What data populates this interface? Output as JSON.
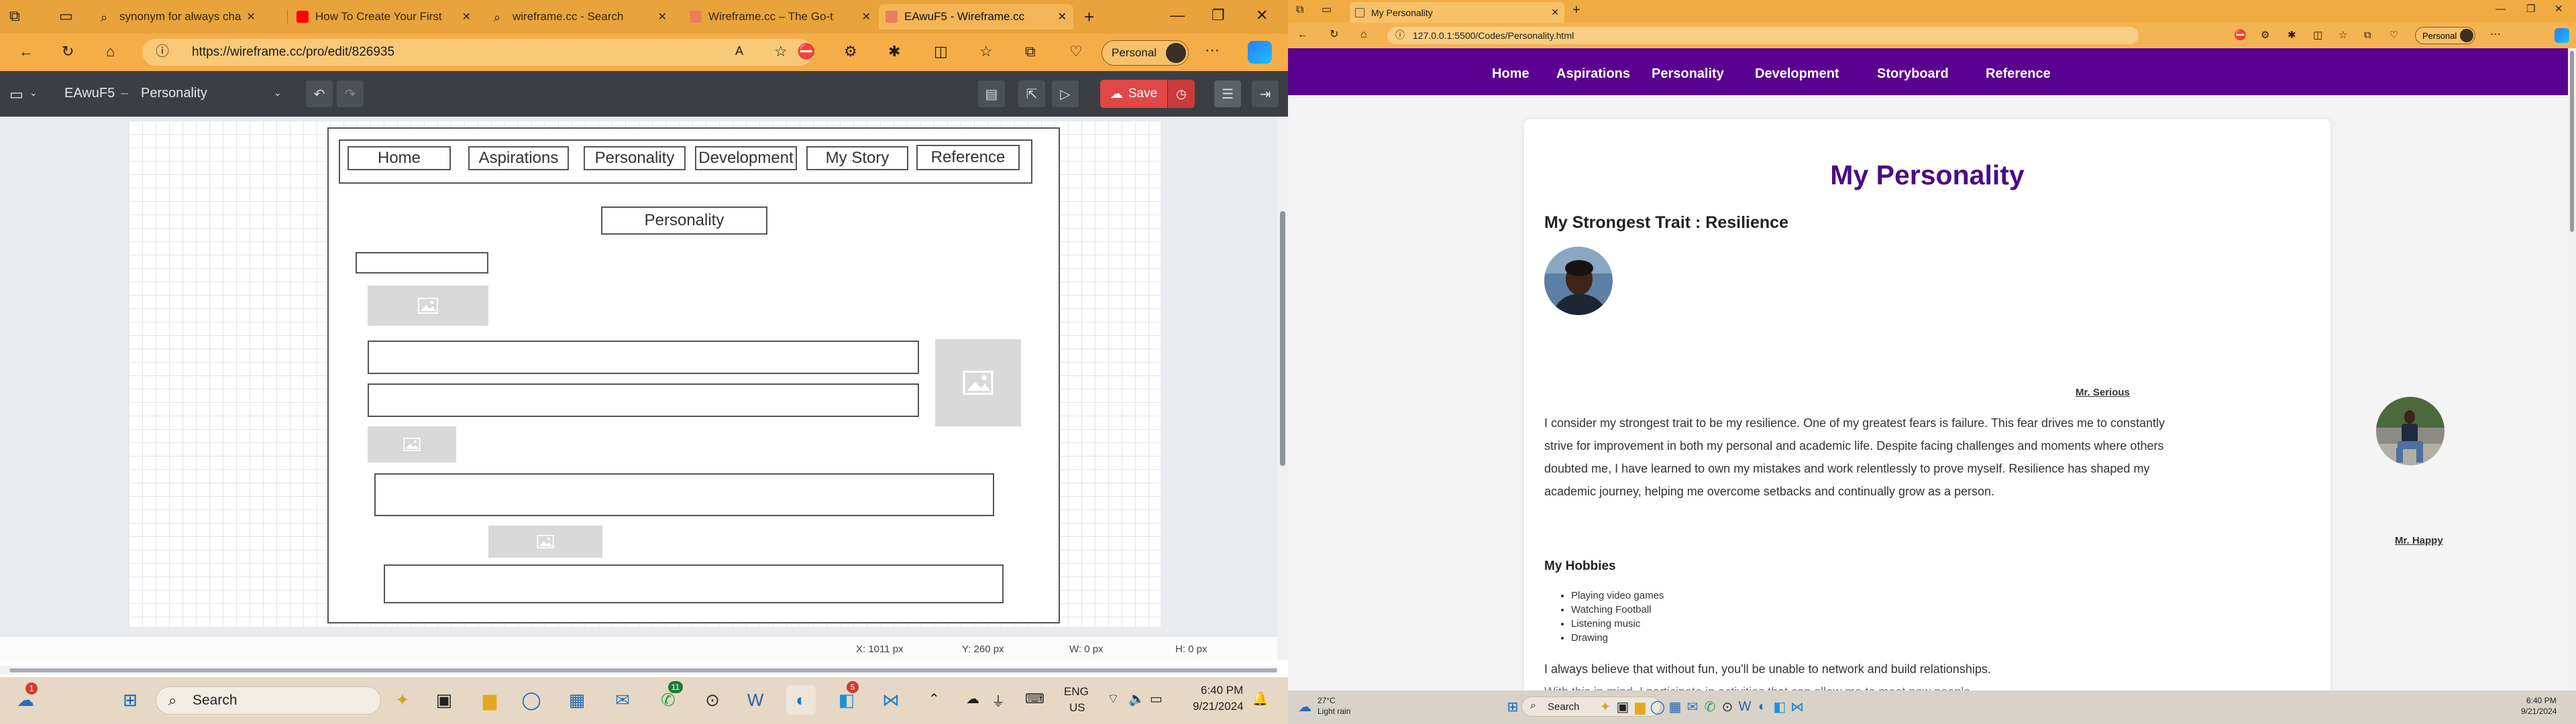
{
  "left": {
    "tabs": [
      {
        "title": "synonym for always cha",
        "icon": "search-icon",
        "color": "#e2a13f"
      },
      {
        "title": "How To Create Your First",
        "icon": "youtube-icon",
        "color": "#ff0000"
      },
      {
        "title": "wireframe.cc - Search",
        "icon": "search-icon",
        "color": "#e2a13f"
      },
      {
        "title": "Wireframe.cc – The Go-t",
        "icon": "wireframe-icon",
        "color": "#e97f5b"
      },
      {
        "title": "EAwuF5 - Wireframe.cc",
        "icon": "wireframe-icon",
        "color": "#e97f5b",
        "active": true
      }
    ],
    "url": "https://wireframe.cc/pro/edit/826935",
    "profile": "Personal",
    "app": {
      "doc_id": "EAwuF5",
      "separator": "–",
      "page_name": "Personality",
      "save_label": "Save"
    },
    "wireframe": {
      "nav": [
        "Home",
        "Aspirations",
        "Personality",
        "Development",
        "My Story",
        "Reference"
      ],
      "page_title": "Personality"
    },
    "status": {
      "x": "X: 1011 px",
      "y": "Y: 260 px",
      "w": "W: 0 px",
      "h": "H: 0 px"
    },
    "taskbar": {
      "search": "Search",
      "lang": "ENG",
      "region": "US",
      "time": "6:40 PM",
      "date": "9/21/2024",
      "notif_badge": "1",
      "whatsapp_badge": "11",
      "edge_badge": "5"
    }
  },
  "right": {
    "tab_title": "My Personality",
    "url": "127.0.0.1:5500/Codes/Personality.html",
    "profile": "Personal",
    "nav": [
      "Home",
      "Aspirations",
      "Personality",
      "Development",
      "Storyboard",
      "Reference"
    ],
    "page": {
      "title": "My Personality",
      "subtitle": "My Strongest Trait : Resilience",
      "photo1_caption": "Mr. Serious",
      "photo2_caption": "Mr. Happy",
      "paragraph": "I consider my strongest trait to be my resilience. One of my greatest fears is failure. This fear drives me to constantly strive for improvement in both my personal and academic life. Despite facing challenges and moments where others doubted me, I have learned to own my mistakes and work relentlessly to prove myself. Resilience has shaped my academic journey, helping me overcome setbacks and continually grow as a person.",
      "hobbies_heading": "My Hobbies",
      "hobbies": [
        "Playing video games",
        "Watching Football",
        "Listening music",
        "Drawing"
      ],
      "para2": "I always believe that without fun, you'll be unable to network and build relationships.",
      "para3": "With this in mind, I participate in activities that can allow me to meet new people"
    },
    "taskbar": {
      "weather_temp": "27°C",
      "weather_desc": "Light rain",
      "search": "Search",
      "time": "6:40 PM",
      "date": "9/21/2024"
    }
  }
}
